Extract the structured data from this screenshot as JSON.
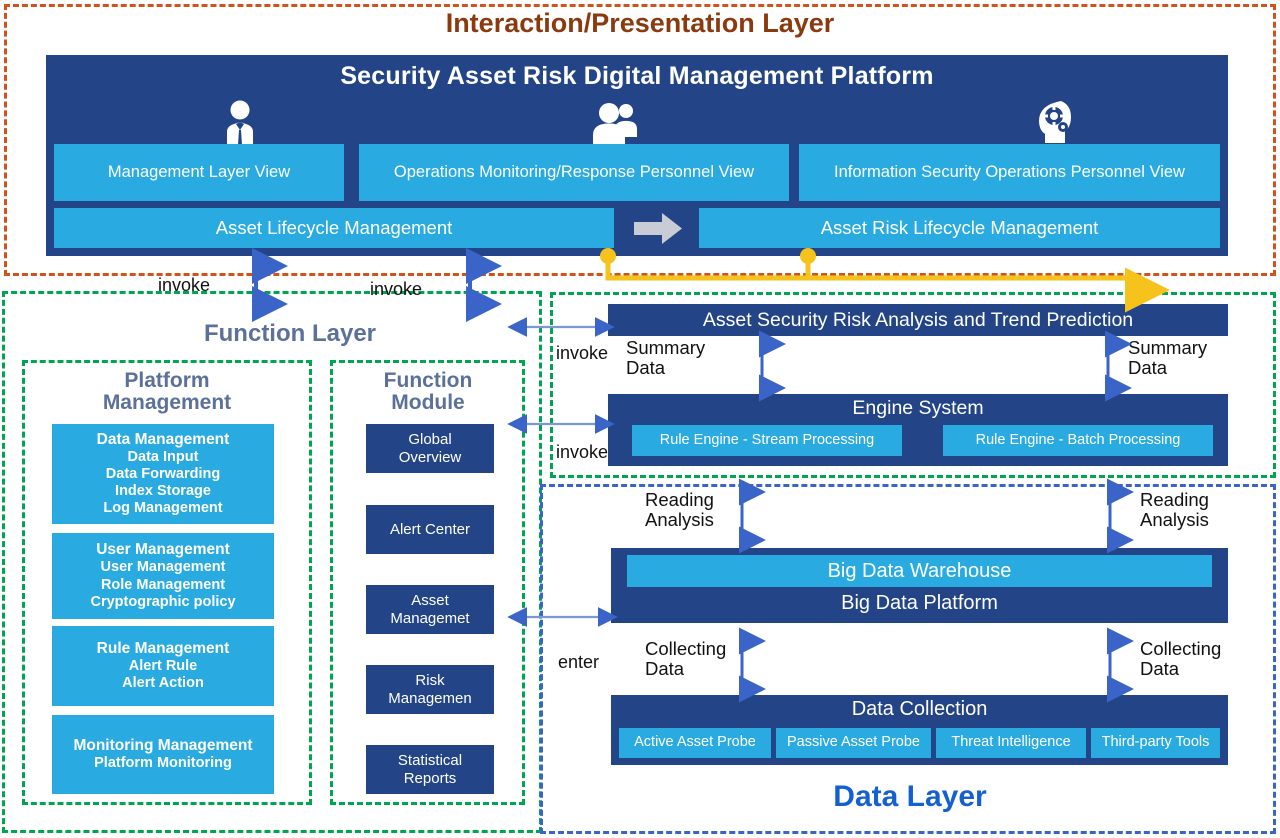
{
  "layers": {
    "interaction_title": "Interaction/Presentation Layer",
    "function_title": "Function Layer",
    "data_title": "Data Layer"
  },
  "platform": {
    "title": "Security Asset Risk Digital Management Platform",
    "personas": [
      {
        "icon": "manager-person-icon"
      },
      {
        "icon": "two-people-icon"
      },
      {
        "icon": "head-with-gears-icon"
      }
    ],
    "views": [
      "Management Layer View",
      "Operations Monitoring/Response Personnel View",
      "Information Security Operations Personnel View"
    ],
    "lifecycles": {
      "left": "Asset Lifecycle Management",
      "right": "Asset Risk Lifecycle Management",
      "arrow_icon": "right-arrow-icon"
    }
  },
  "connectors": {
    "invoke_top_left": "invoke",
    "invoke_top_mid": "invoke",
    "invoke_analysis": "invoke",
    "invoke_engine": "invoke",
    "enter_bigdata": "enter",
    "summary_data_left": "Summary\nData",
    "summary_data_left_l1": "Summary",
    "summary_data_left_l2": "Data",
    "summary_data_right_l1": "Summary",
    "summary_data_right_l2": "Data",
    "reading_analysis_left_l1": "Reading",
    "reading_analysis_left_l2": "Analysis",
    "reading_analysis_right_l1": "Reading",
    "reading_analysis_right_l2": "Analysis",
    "collecting_data_left_l1": "Collecting",
    "collecting_data_left_l2": "Data",
    "collecting_data_right_l1": "Collecting",
    "collecting_data_right_l2": "Data"
  },
  "platform_management": {
    "title_l1": "Platform",
    "title_l2": "Management",
    "cards": [
      {
        "head": "Data Management",
        "subs": [
          "Data Input",
          "Data Forwarding",
          "Index Storage",
          "Log Management"
        ]
      },
      {
        "head": "User Management",
        "subs": [
          "User Management",
          "Role Management",
          "Cryptographic policy"
        ]
      },
      {
        "head": "Rule Management",
        "subs": [
          "Alert Rule",
          "Alert Action"
        ]
      },
      {
        "head": "Monitoring Management",
        "subs": [
          "Platform Monitoring"
        ]
      }
    ]
  },
  "function_module": {
    "title_l1": "Function",
    "title_l2": "Module",
    "cards": [
      {
        "l1": "Global",
        "l2": "Overview"
      },
      {
        "l1": "Alert Center",
        "l2": ""
      },
      {
        "l1": "Asset",
        "l2": "Managemet"
      },
      {
        "l1": "Risk",
        "l2": "Managemen"
      },
      {
        "l1": "Statistical",
        "l2": "Reports"
      }
    ]
  },
  "analysis_panel": {
    "title": "Asset Security Risk Analysis and Trend Prediction"
  },
  "engine_panel": {
    "title": "Engine System",
    "chips": [
      "Rule Engine - Stream Processing",
      "Rule Engine - Batch Processing"
    ]
  },
  "bigdata_panel": {
    "warehouse": "Big Data Warehouse",
    "platform": "Big Data Platform"
  },
  "collection_panel": {
    "title": "Data Collection",
    "chips": [
      "Active Asset Probe",
      "Passive Asset Probe",
      "Threat Intelligence",
      "Third-party Tools"
    ]
  },
  "colors": {
    "dark_blue": "#234486",
    "light_blue": "#29abe2",
    "orange_dash": "#d1531b",
    "green_dash": "#00a550",
    "blue_dash": "#3a64c8",
    "yellow_arrow": "#f5c31c",
    "arrow_blue": "#3a64c8",
    "title_orange": "#8b3a10",
    "title_slate": "#5b7199",
    "title_blue": "#1560d0"
  }
}
